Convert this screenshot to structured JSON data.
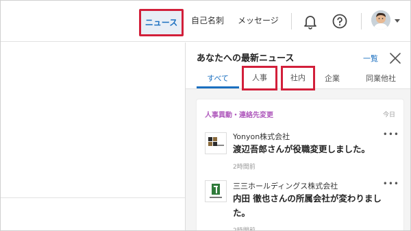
{
  "header": {
    "nav": {
      "news": "ニュース",
      "meishi": "自己名刺",
      "messages": "メッセージ"
    },
    "icons": {
      "notifications": "bell-icon",
      "help": "help-circle-icon",
      "avatar": "user-avatar",
      "menu": "caret-down-icon"
    }
  },
  "panel": {
    "title": "あなたへの最新ニュース",
    "list_link": "一覧",
    "close_icon": "close-icon",
    "tabs": [
      {
        "label": "すべて",
        "active": true
      },
      {
        "label": "人事",
        "active": false
      },
      {
        "label": "社内",
        "active": false
      },
      {
        "label": "企業",
        "active": false
      },
      {
        "label": "同業他社",
        "active": false
      }
    ],
    "card": {
      "category": "人事異動・連絡先変更",
      "date": "今日",
      "items": [
        {
          "company": "Yonyon株式会社",
          "headline": "渡辺吾郎さんが役職変更しました。",
          "time": "2時間前",
          "more": "•••"
        },
        {
          "company": "三三ホールディングス株式会社",
          "headline": "内田 徹也さんの所属会社が変わりました。",
          "time": "2時間前",
          "more": "•••"
        }
      ]
    }
  },
  "colors": {
    "accent": "#1a6fc0",
    "highlight_border": "#d21f3a",
    "category": "#b05bbd"
  }
}
